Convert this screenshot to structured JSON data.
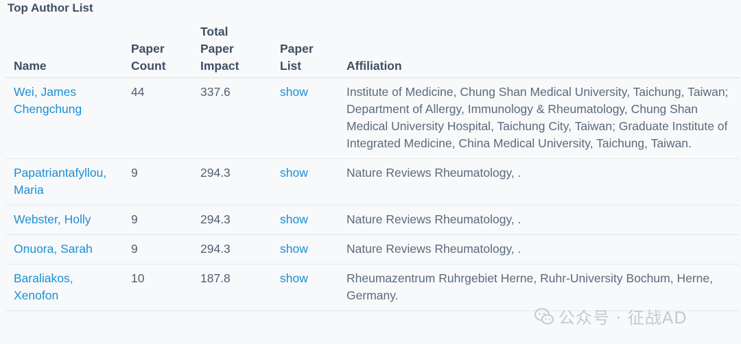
{
  "title": "Top Author List",
  "columns": {
    "name": "Name",
    "count_line1": "Paper",
    "count_line2": "Count",
    "impact_line1": "Total",
    "impact_line2": "Paper",
    "impact_line3": "Impact",
    "list_line1": "Paper",
    "list_line2": "List",
    "affiliation": "Affiliation"
  },
  "rows": [
    {
      "name": "Wei, James Chengchung",
      "count": "44",
      "impact": "337.6",
      "list": "show",
      "affiliation": "Institute of Medicine, Chung Shan Medical University, Taichung, Taiwan; Department of Allergy, Immunology & Rheumatology, Chung Shan Medical University Hospital, Taichung City, Taiwan; Graduate Institute of Integrated Medicine, China Medical University, Taichung, Taiwan."
    },
    {
      "name": "Papatriantafyllou, Maria",
      "count": "9",
      "impact": "294.3",
      "list": "show",
      "affiliation": "Nature Reviews Rheumatology, ."
    },
    {
      "name": "Webster, Holly",
      "count": "9",
      "impact": "294.3",
      "list": "show",
      "affiliation": "Nature Reviews Rheumatology, ."
    },
    {
      "name": "Onuora, Sarah",
      "count": "9",
      "impact": "294.3",
      "list": "show",
      "affiliation": "Nature Reviews Rheumatology, ."
    },
    {
      "name": "Baraliakos, Xenofon",
      "count": "10",
      "impact": "187.8",
      "list": "show",
      "affiliation": "Rheumazentrum Ruhrgebiet Herne, Ruhr-University Bochum, Herne, Germany."
    }
  ],
  "watermark": {
    "icon": "wechat-icon",
    "text": "公众号 · 征战AD"
  },
  "colors": {
    "link": "#1a8fd6",
    "text": "#4f5f73",
    "background": "#f8f9fa"
  }
}
